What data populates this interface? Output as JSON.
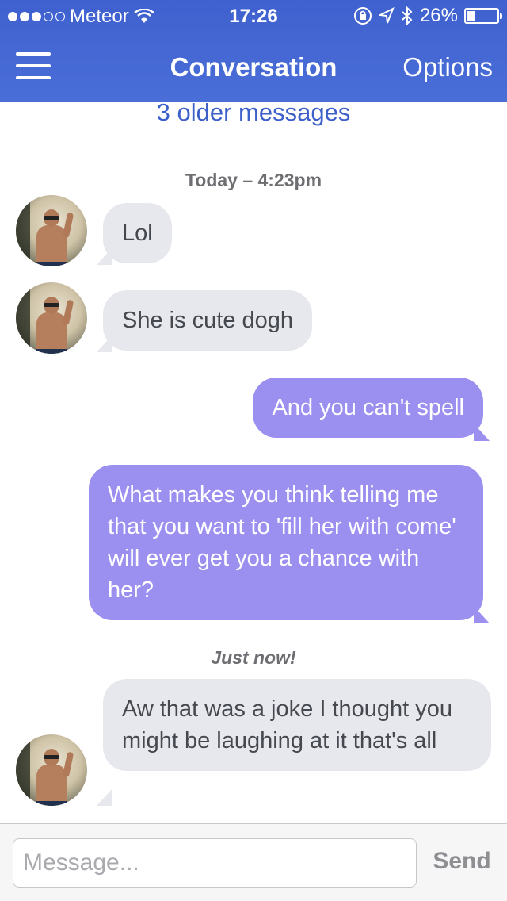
{
  "status_bar": {
    "carrier": "Meteor",
    "time": "17:26",
    "battery_percent": "26%",
    "battery_level": 0.26,
    "signal_bars_filled": 3,
    "signal_bars_total": 5
  },
  "nav": {
    "menu_icon": "hamburger-menu-icon",
    "title": "Conversation",
    "options_label": "Options"
  },
  "conversation": {
    "older_messages_link": "3 older messages",
    "timestamp_1": "Today – 4:23pm",
    "timestamp_2": "Just now!",
    "messages": [
      {
        "direction": "incoming",
        "text": "Lol"
      },
      {
        "direction": "incoming",
        "text": "She is cute dogh"
      },
      {
        "direction": "outgoing",
        "text": "And you can't spell"
      },
      {
        "direction": "outgoing",
        "text": "What makes you think telling me that you want to 'fill her with come' will ever get you a chance with her?"
      },
      {
        "direction": "incoming",
        "text": "Aw that was a joke I thought you might be laughing at it that's all"
      }
    ]
  },
  "composer": {
    "placeholder": "Message...",
    "value": "",
    "send_label": "Send"
  },
  "colors": {
    "header_blue": "#4a6ed8",
    "incoming_bubble": "#e7e8ee",
    "outgoing_bubble": "#9b8ff0",
    "link_blue": "#3c5fc9"
  }
}
